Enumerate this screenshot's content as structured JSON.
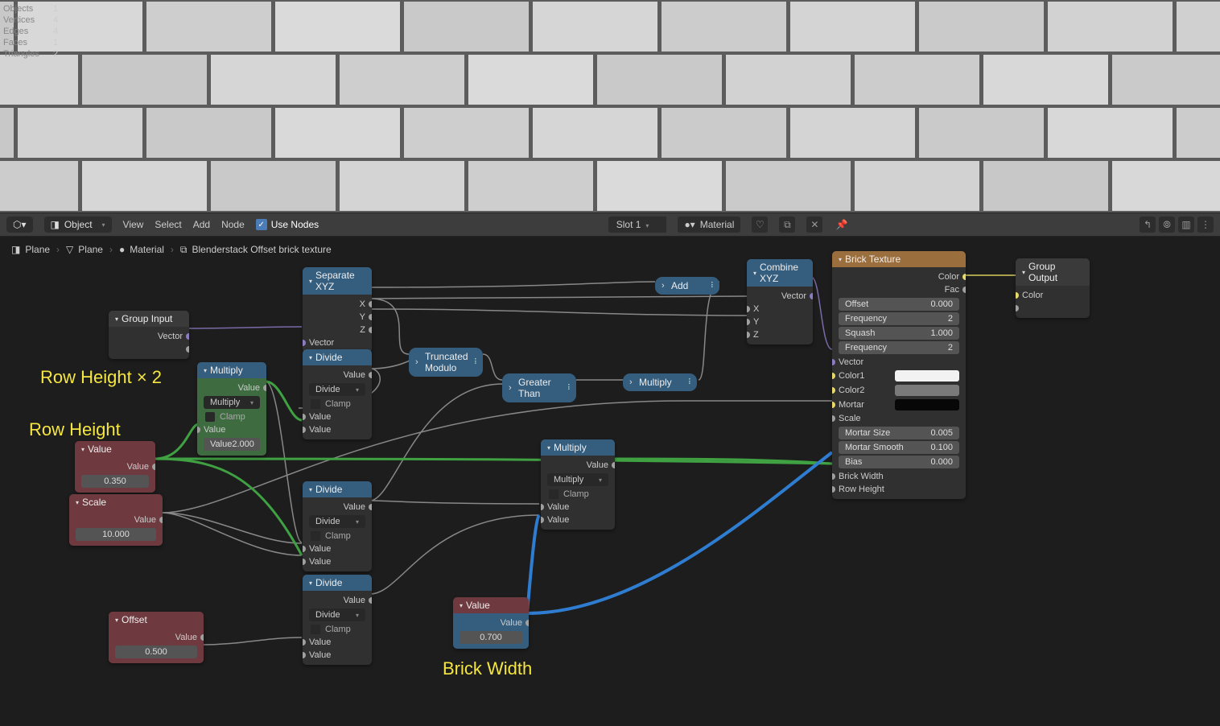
{
  "stats": {
    "objects": {
      "label": "Objects",
      "val": "1"
    },
    "vertices": {
      "label": "Vertices",
      "val": "4"
    },
    "edges": {
      "label": "Edges",
      "val": "4"
    },
    "faces": {
      "label": "Faces",
      "val": "1"
    },
    "triangles": {
      "label": "Triangles",
      "val": "2"
    }
  },
  "header": {
    "mode": "Object",
    "menus": {
      "view": "View",
      "select": "Select",
      "add": "Add",
      "node": "Node"
    },
    "use_nodes": "Use Nodes",
    "slot": "Slot 1",
    "material": "Material"
  },
  "breadcrumb": {
    "plane1": "Plane",
    "plane2": "Plane",
    "material": "Material",
    "group": "Blenderstack Offset brick texture"
  },
  "annotations": {
    "row_height_x2": "Row Height × 2",
    "row_height": "Row Height",
    "brick_width": "Brick Width"
  },
  "nodes": {
    "group_input": {
      "title": "Group Input",
      "vector": "Vector"
    },
    "separate_xyz": {
      "title": "Separate XYZ",
      "x": "X",
      "y": "Y",
      "z": "Z",
      "vector": "Vector"
    },
    "value_row_height": {
      "title": "Value",
      "value_lbl": "Value",
      "value": "0.350"
    },
    "scale": {
      "title": "Scale",
      "value_lbl": "Value",
      "value": "10.000"
    },
    "offset": {
      "title": "Offset",
      "value_lbl": "Value",
      "value": "0.500"
    },
    "value_brick_width": {
      "title": "Value",
      "value_lbl": "Value",
      "value": "0.700"
    },
    "multiply1": {
      "title": "Multiply",
      "value_out": "Value",
      "op": "Multiply",
      "clamp": "Clamp",
      "value_in": "Value",
      "value_num_lbl": "Value",
      "value_num": "2.000"
    },
    "divide1": {
      "title": "Divide",
      "value_out": "Value",
      "op": "Divide",
      "clamp": "Clamp",
      "value_a": "Value",
      "value_b": "Value"
    },
    "divide2": {
      "title": "Divide",
      "value_out": "Value",
      "op": "Divide",
      "clamp": "Clamp",
      "value_a": "Value",
      "value_b": "Value"
    },
    "divide3": {
      "title": "Divide",
      "value_out": "Value",
      "op": "Divide",
      "clamp": "Clamp",
      "value_a": "Value",
      "value_b": "Value"
    },
    "trunc_mod": "Truncated Modulo",
    "greater_than": "Greater Than",
    "multiply_pill": "Multiply",
    "add_pill": "Add",
    "multiply2": {
      "title": "Multiply",
      "value_out": "Value",
      "op": "Multiply",
      "clamp": "Clamp",
      "value_a": "Value",
      "value_b": "Value"
    },
    "combine_xyz": {
      "title": "Combine XYZ",
      "vector": "Vector",
      "x": "X",
      "y": "Y",
      "z": "Z"
    },
    "brick": {
      "title": "Brick Texture",
      "color_out": "Color",
      "fac_out": "Fac",
      "offset_lbl": "Offset",
      "offset": "0.000",
      "freq1_lbl": "Frequency",
      "freq1": "2",
      "squash_lbl": "Squash",
      "squash": "1.000",
      "freq2_lbl": "Frequency",
      "freq2": "2",
      "vector": "Vector",
      "color1": "Color1",
      "color2": "Color2",
      "mortar": "Mortar",
      "scale": "Scale",
      "mortar_size_lbl": "Mortar Size",
      "mortar_size": "0.005",
      "mortar_smooth_lbl": "Mortar Smooth",
      "mortar_smooth": "0.100",
      "bias_lbl": "Bias",
      "bias": "0.000",
      "brick_width": "Brick Width",
      "row_height": "Row Height"
    },
    "group_output": {
      "title": "Group Output",
      "color": "Color"
    }
  }
}
